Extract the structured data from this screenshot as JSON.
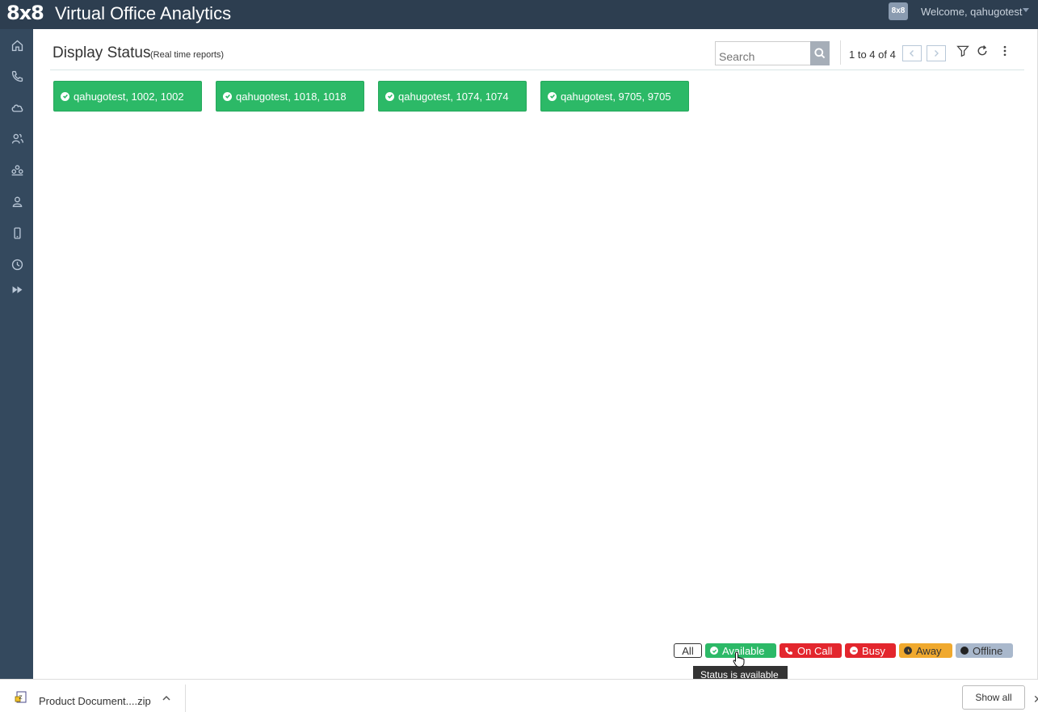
{
  "header": {
    "logo": "8x8",
    "app_title": "Virtual Office Analytics",
    "avatar_text": "8x8",
    "welcome": "Welcome, qahugotest"
  },
  "sidebar": {
    "items": [
      {
        "icon": "home-icon"
      },
      {
        "icon": "phone-icon"
      },
      {
        "icon": "cloud-icon"
      },
      {
        "icon": "users-icon"
      },
      {
        "icon": "groups-icon"
      },
      {
        "icon": "user-icon"
      },
      {
        "icon": "mobile-icon"
      },
      {
        "icon": "clock-icon"
      },
      {
        "icon": "fast-forward-icon"
      }
    ]
  },
  "page": {
    "title": "Display Status",
    "subtitle": "(Real time reports)"
  },
  "toolbar": {
    "search_placeholder": "Search",
    "pager_text": "1 to 4 of 4"
  },
  "cards": [
    {
      "label": "qahugotest, 1002, 1002",
      "status": "available"
    },
    {
      "label": "qahugotest, 1018, 1018",
      "status": "available"
    },
    {
      "label": "qahugotest, 1074, 1074",
      "status": "available"
    },
    {
      "label": "qahugotest, 9705, 9705",
      "status": "available"
    }
  ],
  "legend": {
    "all": "All",
    "available": "Available",
    "on_call": "On Call",
    "busy": "Busy",
    "away": "Away",
    "offline": "Offline",
    "tooltip": "Status is available"
  },
  "colors": {
    "available": "#2cb967",
    "on_call": "#e3262d",
    "busy": "#e3262d",
    "away": "#f0a92e",
    "offline": "#a9b8cc",
    "topbar": "#2d3e50",
    "sidebar": "#34495e"
  },
  "download_bar": {
    "file_name": "Product Document....zip",
    "show_all": "Show all"
  }
}
